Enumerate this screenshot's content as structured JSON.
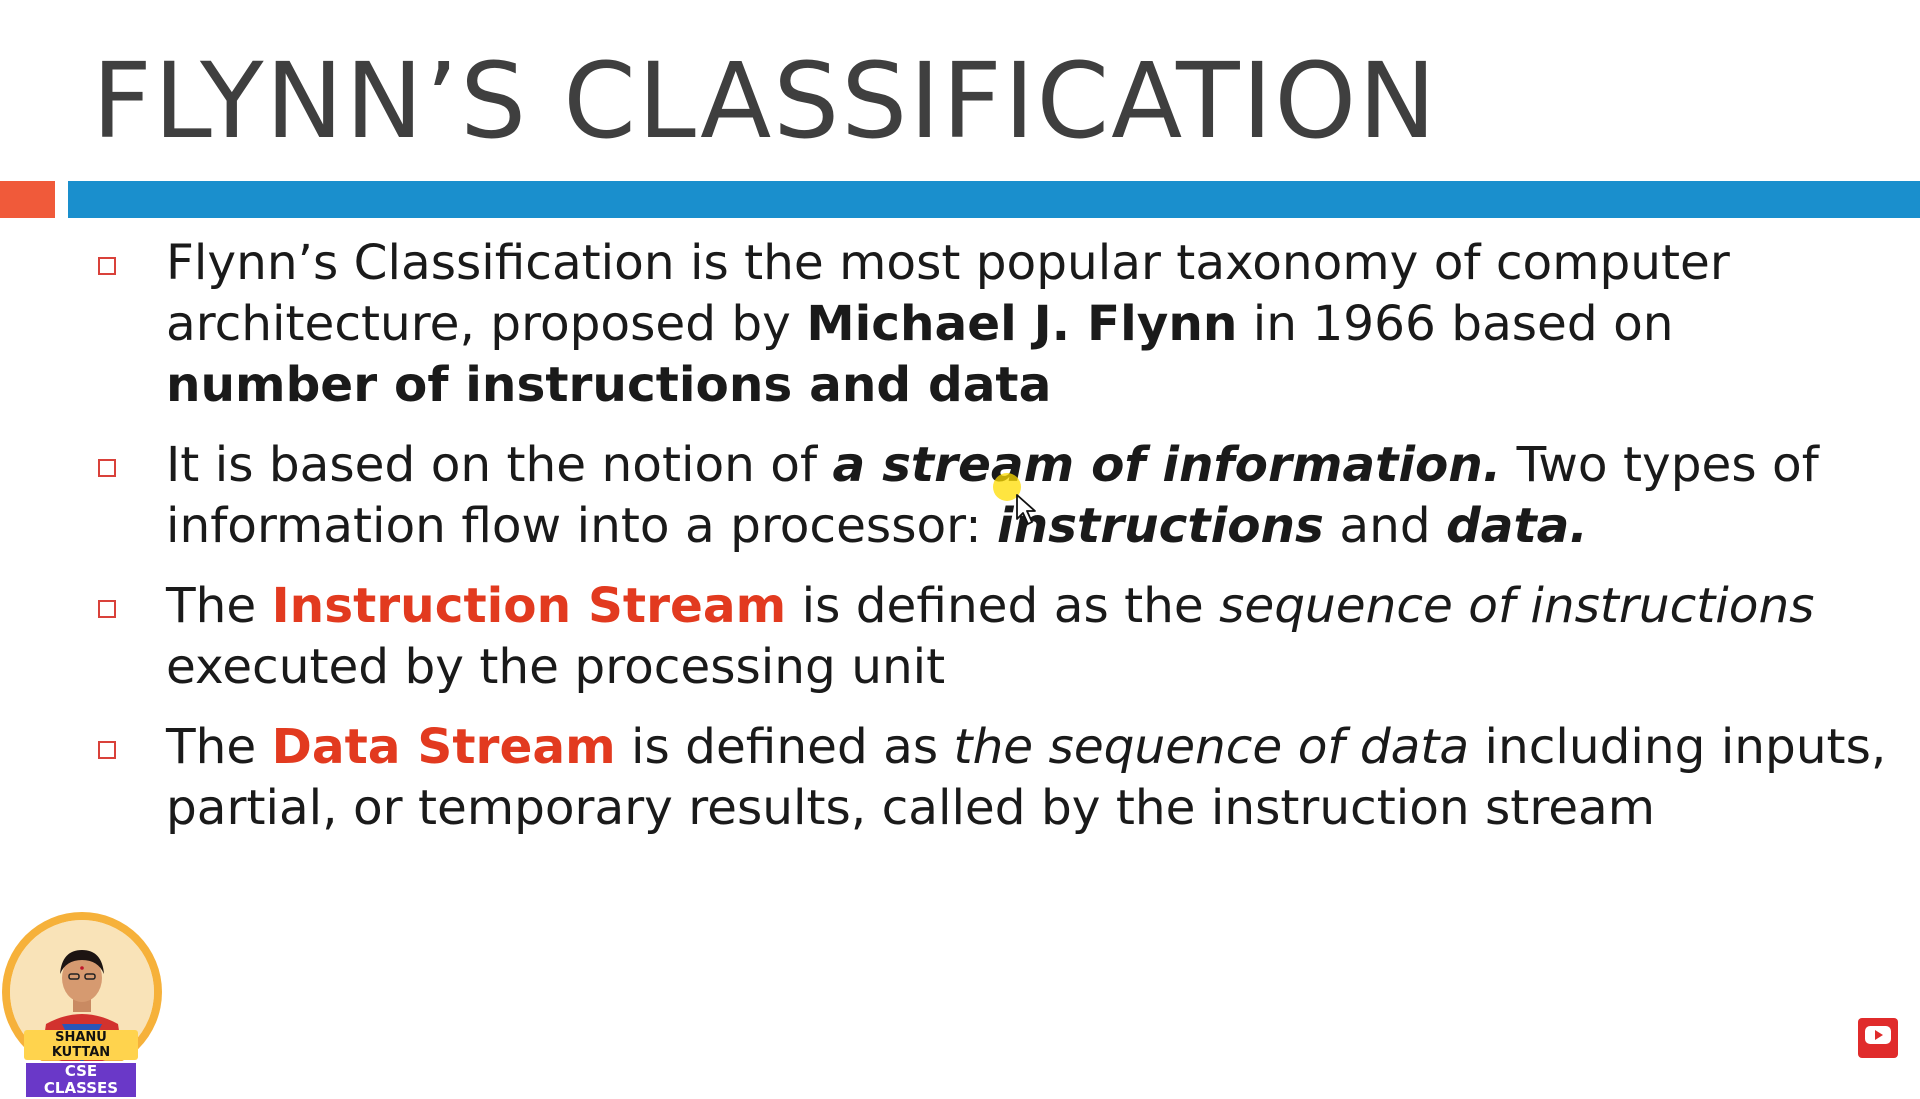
{
  "slide": {
    "title": "FLYNN’S CLASSIFICATION",
    "bullets": [
      {
        "runs": [
          {
            "text": "Flynn’s Classification is the most popular taxonomy of computer architecture, proposed by ",
            "style": "normal"
          },
          {
            "text": "Michael J. Flynn",
            "style": "bold"
          },
          {
            "text": " in 1966 based on ",
            "style": "normal"
          },
          {
            "text": "number of instructions and data",
            "style": "bold"
          }
        ]
      },
      {
        "runs": [
          {
            "text": "It is based on the notion of ",
            "style": "normal"
          },
          {
            "text": "a stream of information.",
            "style": "bold-italic"
          },
          {
            "text": " Two types of information flow into a processor: ",
            "style": "normal"
          },
          {
            "text": "instructions",
            "style": "bold-italic"
          },
          {
            "text": " and ",
            "style": "normal"
          },
          {
            "text": "data.",
            "style": "bold-italic"
          }
        ]
      },
      {
        "runs": [
          {
            "text": "The ",
            "style": "normal"
          },
          {
            "text": "Instruction Stream",
            "style": "red-bold"
          },
          {
            "text": " is defined as the ",
            "style": "normal"
          },
          {
            "text": "sequence of instructions",
            "style": "italic"
          },
          {
            "text": " executed by the processing unit",
            "style": "normal"
          }
        ]
      },
      {
        "runs": [
          {
            "text": "The ",
            "style": "normal"
          },
          {
            "text": "Data Stream",
            "style": "red-bold"
          },
          {
            "text": " is defined as ",
            "style": "normal"
          },
          {
            "text": "the sequence of data",
            "style": "italic"
          },
          {
            "text": " including inputs, partial, or temporary results, called by the instruction stream",
            "style": "normal"
          }
        ]
      }
    ]
  },
  "channel": {
    "name": "SHANU KUTTAN",
    "subtitle": "CSE CLASSES"
  },
  "colors": {
    "accent_orange": "#f05a3a",
    "accent_blue": "#1a8fcd",
    "highlight_red": "#e23a1f",
    "bullet_box": "#d9413a"
  },
  "icons": [
    "bullet-box-icon",
    "cursor-icon",
    "subscribe-icon"
  ]
}
